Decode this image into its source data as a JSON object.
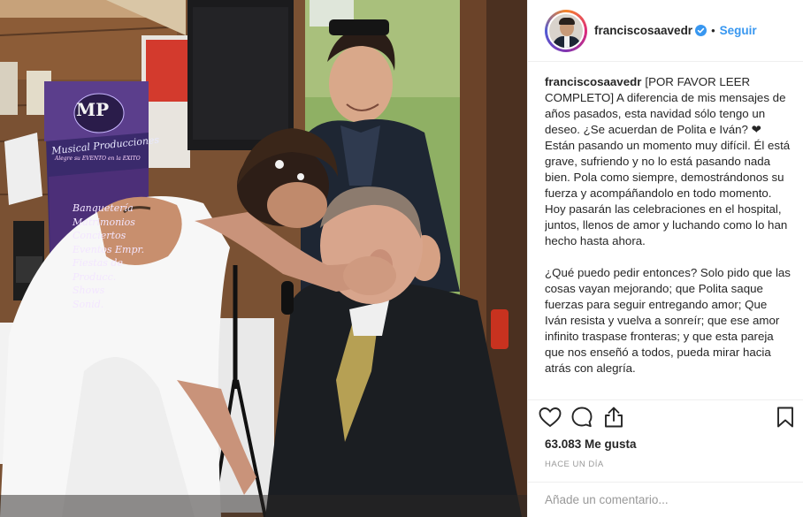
{
  "post": {
    "username": "franciscosaavedr",
    "verified": true,
    "separator": "•",
    "follow_label": "Seguir",
    "caption_paragraph_1": "[POR FAVOR LEER COMPLETO] A diferencia de mis mensajes de años pasados, esta navidad sólo tengo un deseo. ¿Se acuerdan de Polita e Iván? ❤ Están pasando un momento muy difícil. Él está grave, sufriendo y no lo está pasando nada bien. Pola como siempre, demostrándonos su fuerza y acompáñandolo en todo momento. Hoy pasarán las celebraciones en el hospital, juntos, llenos de amor y luchando como lo han hecho hasta ahora.",
    "caption_paragraph_2": "¿Qué puedo pedir entonces? Solo pido que las cosas vayan mejorando; que Polita saque fuerzas para seguir entregando amor; Que Iván resista y vuelva a sonreír; que ese amor infinito traspase fronteras; y que esta pareja que nos enseñó a todos, pueda mirar hacia atrás con alegría.",
    "likes": "63.083 Me gusta",
    "timestamp": "HACE UN DÍA",
    "comment_placeholder": "Añade un comentario..."
  },
  "photo": {
    "banner_logo": "MP",
    "banner_title": "Musical Producciones",
    "banner_subtitle": "Alegre su EVENTO en la EXITO",
    "banner_items": [
      "Banquetería",
      "Matrimonios",
      "Conciertos",
      "Eventos Empr.",
      "Fiestas de",
      "Producc.",
      "Shows",
      "Sonid."
    ]
  },
  "icons": {
    "avatar": "profile-photo",
    "verified": "verified-badge-icon",
    "like": "heart-icon",
    "comment": "comment-bubble-icon",
    "share": "share-icon",
    "save": "bookmark-icon"
  },
  "colors": {
    "accent": "#3897f0",
    "text": "#262626",
    "muted": "#999999",
    "border": "#efefef"
  }
}
